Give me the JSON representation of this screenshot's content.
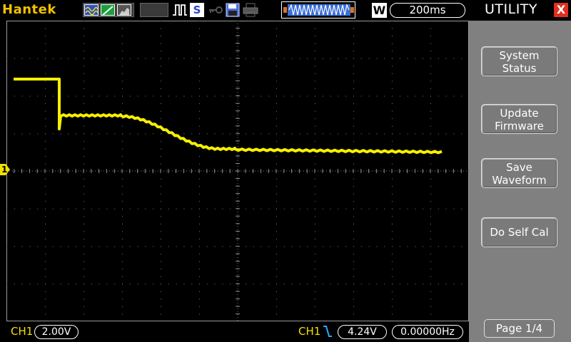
{
  "header": {
    "brand": "Hantek",
    "icons": [
      "waveform-mode-icon",
      "xy-mode-icon",
      "persistence-icon",
      "pulse-icon",
      "single-shot-icon",
      "key-lock-icon",
      "save-disk-icon",
      "printer-icon",
      "timebase-overview-icon"
    ],
    "single_label": "S",
    "window_label": "W",
    "timebase": "200ms"
  },
  "screen": {
    "ch1_marker": "1",
    "trace_color": "#f5f000"
  },
  "footer": {
    "ch_label": "CH1",
    "ch_scale": "2.00V",
    "trig_channel": "CH1",
    "trig_level": "4.24V",
    "trig_freq": "0.00000Hz"
  },
  "menu": {
    "title": "UTILITY",
    "close": "X",
    "buttons": [
      {
        "line1": "System",
        "line2": "Status"
      },
      {
        "line1": "Update",
        "line2": "Firmware"
      },
      {
        "line1": "Save",
        "line2": "Waveform"
      },
      {
        "line1": "Do Self Cal",
        "line2": ""
      }
    ],
    "page": "Page 1/4"
  },
  "colors": {
    "accent_yellow": "#f2e000",
    "brand_gold": "#f2c200",
    "close_red": "#e0301e",
    "panel_gray": "#808080"
  }
}
